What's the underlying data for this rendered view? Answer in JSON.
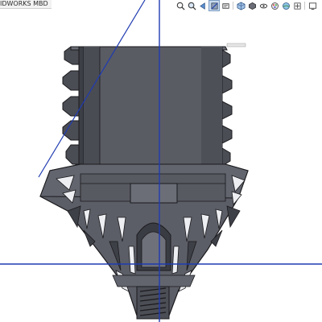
{
  "document_tab": {
    "label": "IDWORKS MBD"
  },
  "heads_up_toolbar": {
    "icons": [
      "zoom-to-fit-icon",
      "zoom-to-area-icon",
      "previous-view-icon",
      "section-view-icon",
      "dynamic-annotation-icon",
      "view-orientation-icon",
      "display-style-icon",
      "hide-show-items-icon",
      "edit-appearance-icon",
      "apply-scene-icon",
      "view-settings-icon",
      "display-pane-icon"
    ],
    "active_icon": "section-view-icon"
  },
  "viewport": {
    "background": "#ffffff",
    "model_color": "#54565f",
    "model_dark": "#35363d",
    "model_light": "#7a7d86",
    "edge_color": "#1a1a1d",
    "section_plane_color": "#1f3bb0"
  }
}
